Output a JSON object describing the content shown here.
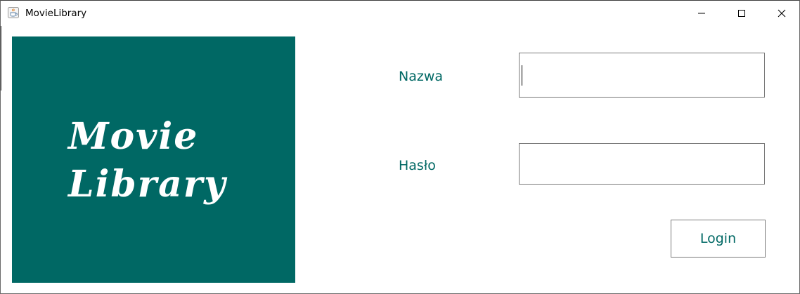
{
  "window": {
    "title": "MovieLibrary"
  },
  "icons": {
    "app": "java-coffee-cup-icon",
    "minimize": "minimize-icon",
    "maximize": "maximize-icon",
    "close": "close-icon"
  },
  "logo": {
    "line1": "Movie",
    "line2": "Library",
    "background_color": "#006864",
    "text_color": "#ffffff"
  },
  "form": {
    "name_label": "Nazwa",
    "name_value": "",
    "password_label": "Hasło",
    "password_value": "",
    "login_label": "Login",
    "accent_color": "#006864"
  }
}
